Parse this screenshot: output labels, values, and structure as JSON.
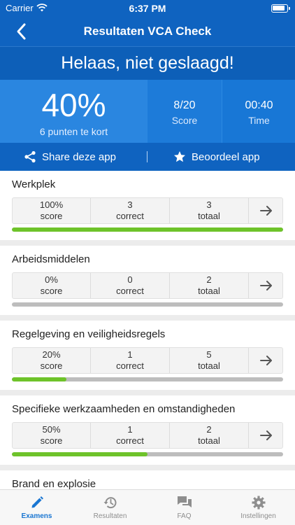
{
  "status": {
    "carrier": "Carrier",
    "time": "6:37 PM"
  },
  "nav": {
    "title": "Resultaten VCA Check"
  },
  "result": {
    "headline": "Helaas, niet geslaagd!",
    "percentage": "40%",
    "shortfall": "6 punten te kort",
    "score_value": "8/20",
    "score_label": "Score",
    "time_value": "00:40",
    "time_label": "Time"
  },
  "actions": {
    "share": "Share deze app",
    "rate": "Beoordeel app"
  },
  "categories": [
    {
      "title": "Werkplek",
      "score": "100%",
      "score_label": "score",
      "correct": "3",
      "correct_label": "correct",
      "total": "3",
      "total_label": "totaal",
      "progress": 1.0
    },
    {
      "title": "Arbeidsmiddelen",
      "score": "0%",
      "score_label": "score",
      "correct": "0",
      "correct_label": "correct",
      "total": "2",
      "total_label": "totaal",
      "progress": 0.0
    },
    {
      "title": "Regelgeving en veiligheidsregels",
      "score": "20%",
      "score_label": "score",
      "correct": "1",
      "correct_label": "correct",
      "total": "5",
      "total_label": "totaal",
      "progress": 0.2
    },
    {
      "title": "Specifieke werkzaamheden en omstandigheden",
      "score": "50%",
      "score_label": "score",
      "correct": "1",
      "correct_label": "correct",
      "total": "2",
      "total_label": "totaal",
      "progress": 0.5
    },
    {
      "title": "Brand en explosie",
      "score": "",
      "score_label": "",
      "correct": "",
      "correct_label": "",
      "total": "",
      "total_label": "",
      "progress": 0.0
    }
  ],
  "tabs": [
    {
      "label": "Examens",
      "icon": "pencil-icon",
      "active": true
    },
    {
      "label": "Resultaten",
      "icon": "history-icon",
      "active": false
    },
    {
      "label": "FAQ",
      "icon": "chat-icon",
      "active": false
    },
    {
      "label": "Instellingen",
      "icon": "gear-icon",
      "active": false
    }
  ],
  "colors": {
    "primary": "#0f63c0",
    "stats": "#2a86e0",
    "progress": "#6ec32a",
    "track": "#bdbdbd",
    "active_tab": "#1a76d2"
  }
}
